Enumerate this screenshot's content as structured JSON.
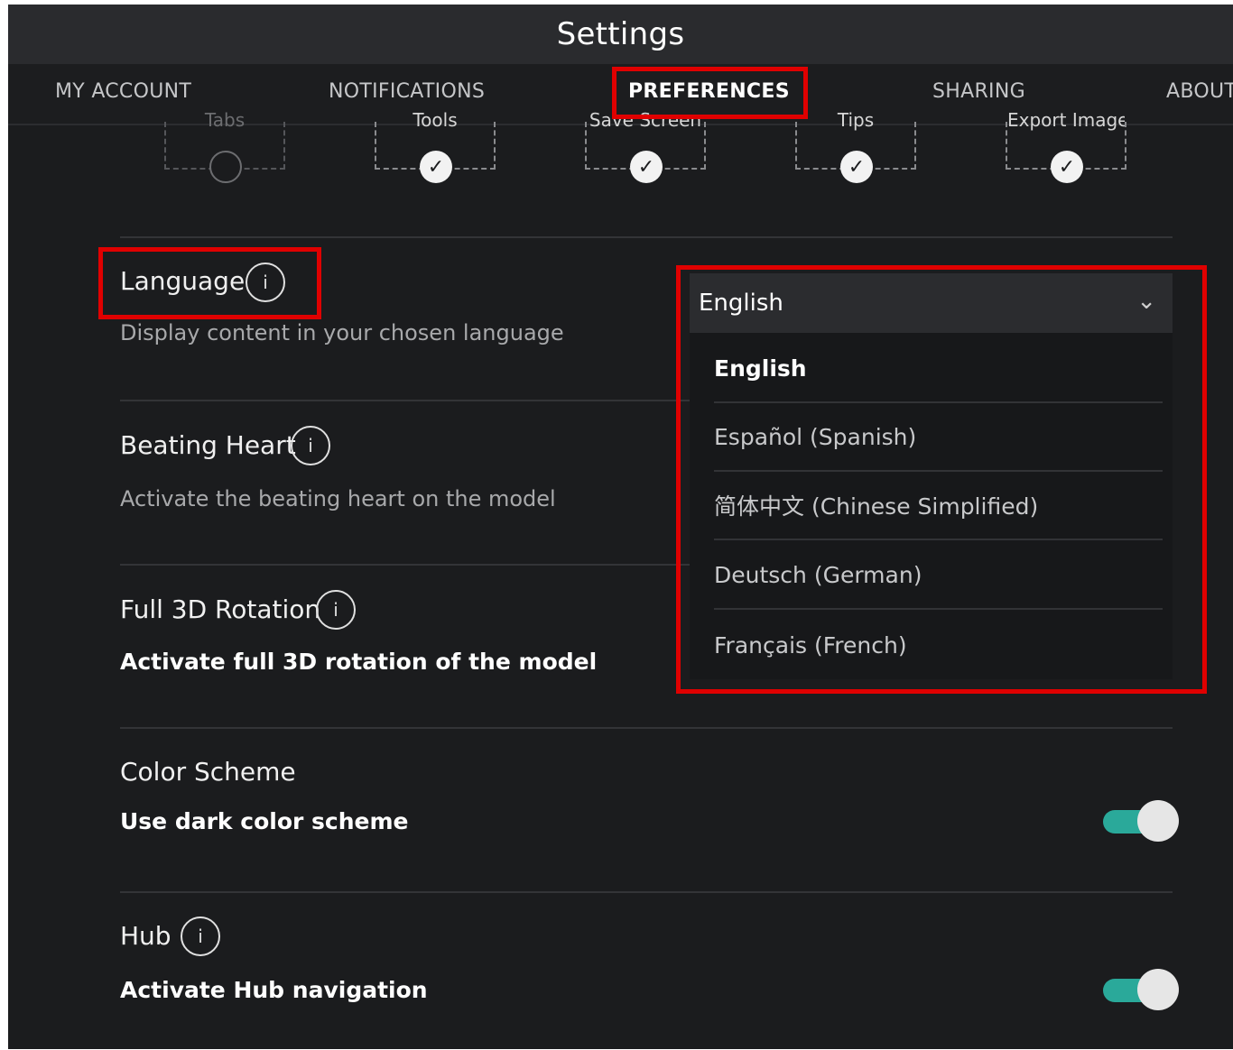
{
  "header": {
    "title": "Settings"
  },
  "tabs": [
    {
      "label": "MY ACCOUNT"
    },
    {
      "label": "NOTIFICATIONS"
    },
    {
      "label": "PREFERENCES",
      "active": true
    },
    {
      "label": "SHARING"
    },
    {
      "label": "ABOUT"
    }
  ],
  "tools": [
    {
      "label": "Tabs",
      "checked": false
    },
    {
      "label": "Tools",
      "checked": true
    },
    {
      "label": "Save Screen",
      "checked": true
    },
    {
      "label": "Tips",
      "checked": true
    },
    {
      "label": "Export Image",
      "checked": true
    }
  ],
  "settings": {
    "language": {
      "title": "Language",
      "desc": "Display content in your chosen language"
    },
    "heart": {
      "title": "Beating Heart",
      "desc": "Activate the beating heart on the model"
    },
    "rotation": {
      "title": "Full 3D Rotation",
      "desc": "Activate full 3D rotation of the model"
    },
    "color": {
      "title": "Color Scheme",
      "desc": "Use dark color scheme",
      "enabled": true
    },
    "hub": {
      "title": "Hub",
      "desc": "Activate Hub navigation",
      "enabled": true
    }
  },
  "language_select": {
    "value": "English",
    "options": [
      "English",
      "Español (Spanish)",
      "简体中文 (Chinese Simplified)",
      "Deutsch (German)",
      "Français (French)"
    ]
  },
  "icons": {
    "info": "i",
    "check": "✓",
    "chevron": "⌄"
  },
  "colors": {
    "accent_toggle": "#2aa99a",
    "highlight": "#e00000",
    "background": "#1b1c1e"
  }
}
